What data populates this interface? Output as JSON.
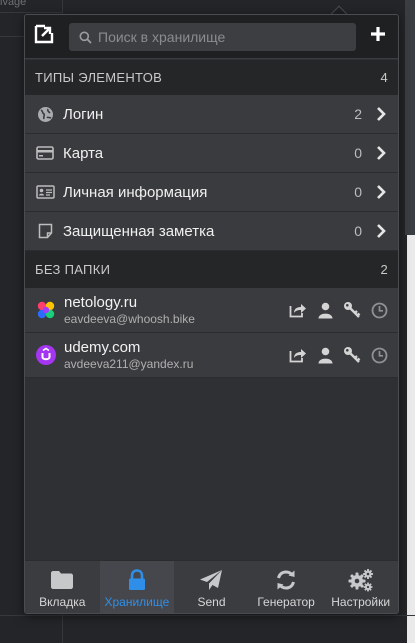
{
  "backdrop": {
    "text": "ivage"
  },
  "search": {
    "placeholder": "Поиск в хранилище"
  },
  "types_section": {
    "title": "ТИПЫ ЭЛЕМЕНТОВ",
    "count": "4",
    "items": [
      {
        "label": "Логин",
        "count": "2",
        "icon": "globe-icon"
      },
      {
        "label": "Карта",
        "count": "0",
        "icon": "credit-card-icon"
      },
      {
        "label": "Личная информация",
        "count": "0",
        "icon": "id-card-icon"
      },
      {
        "label": "Защищенная заметка",
        "count": "0",
        "icon": "note-icon"
      }
    ]
  },
  "nofolder_section": {
    "title": "БЕЗ ПАПКИ",
    "count": "2",
    "items": [
      {
        "name": "netology.ru",
        "login": "eavdeeva@whoosh.bike",
        "icon": "netology-favicon"
      },
      {
        "name": "udemy.com",
        "login": "avdeeva211@yandex.ru",
        "icon": "udemy-favicon"
      }
    ]
  },
  "footer": {
    "tabs": [
      {
        "label": "Вкладка",
        "icon": "folder-icon"
      },
      {
        "label": "Хранилище",
        "icon": "lock-icon"
      },
      {
        "label": "Send",
        "icon": "paper-plane-icon"
      },
      {
        "label": "Генератор",
        "icon": "refresh-icon"
      },
      {
        "label": "Настройки",
        "icon": "gears-icon"
      }
    ]
  },
  "colors": {
    "accent": "#2f8fe8",
    "header_bg": "#1f2022",
    "row_bg": "#3a3b3e",
    "udemy_purple": "#a435f0"
  }
}
